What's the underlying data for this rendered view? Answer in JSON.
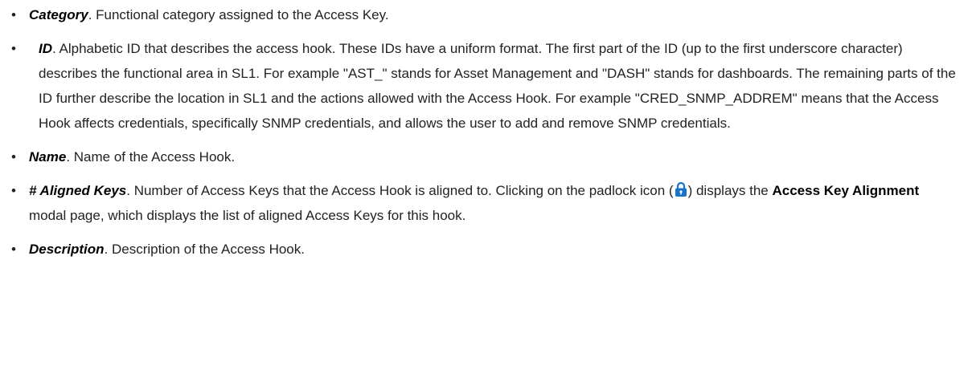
{
  "items": [
    {
      "term": "Category",
      "text": ". Functional category assigned to the Access Key."
    },
    {
      "term": "ID",
      "text": ". Alphabetic ID that describes the access hook. These IDs have a uniform format. The first part of the ID (up to the first underscore character) describes the functional area in SL1. For example \"AST_\" stands for Asset Management and \"DASH\" stands for dashboards. The remaining parts of the ID further describe the location in SL1 and the actions allowed with the Access Hook. For example \"CRED_SNMP_ADDREM\" means that the Access Hook affects credentials, specifically SNMP credentials, and allows the user to add and remove SNMP credentials."
    },
    {
      "term": "Name",
      "text": ". Name of the Access Hook."
    },
    {
      "term": "# Aligned Keys",
      "text_before_icon": ". Number of Access Keys that the Access Hook is aligned to. Clicking on the padlock icon (",
      "text_after_icon": ") displays the ",
      "strong": "Access Key Alignment",
      "text_end": " modal page, which displays the list of aligned Access Keys for this hook.",
      "icon": "padlock-icon",
      "icon_color": "#1a73c9"
    },
    {
      "term": "Description",
      "text": ". Description of the Access Hook."
    }
  ],
  "bullet": "•"
}
